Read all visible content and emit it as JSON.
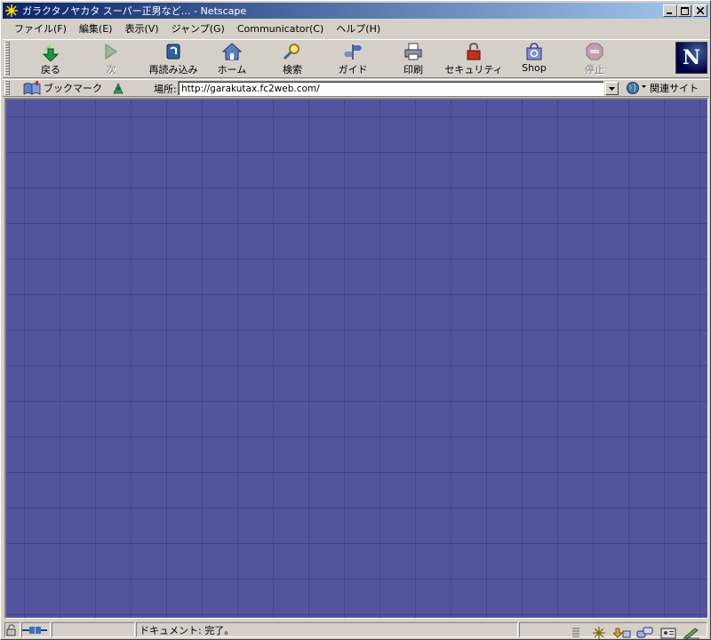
{
  "window": {
    "title": "ガラクタノヤカタ スーパー正男など… - Netscape",
    "buttons": [
      "minimize",
      "maximize",
      "close"
    ]
  },
  "menu": [
    {
      "label": "ファイル(F)"
    },
    {
      "label": "編集(E)"
    },
    {
      "label": "表示(V)"
    },
    {
      "label": "ジャンプ(G)"
    },
    {
      "label": "Communicator(C)"
    },
    {
      "label": "ヘルプ(H)"
    }
  ],
  "toolbar": {
    "back": "戻る",
    "forward": "次",
    "reload": "再読み込み",
    "home": "ホーム",
    "search": "検索",
    "guide": "ガイド",
    "print": "印刷",
    "security": "セキュリティ",
    "shop": "Shop",
    "stop": "停止",
    "logo": "N"
  },
  "location_bar": {
    "bookmarks_label": "ブックマーク",
    "location_label": "場所:",
    "url": "http://garakutax.fc2web.com/",
    "related_label": "関連サイト"
  },
  "content": {
    "background_color": "#54549e"
  },
  "status_bar": {
    "message": "ドキュメント: 完了。"
  },
  "colors": {
    "titlebar_start": "#0a246a",
    "titlebar_end": "#a6caf0",
    "chrome": "#d4d0c8"
  }
}
